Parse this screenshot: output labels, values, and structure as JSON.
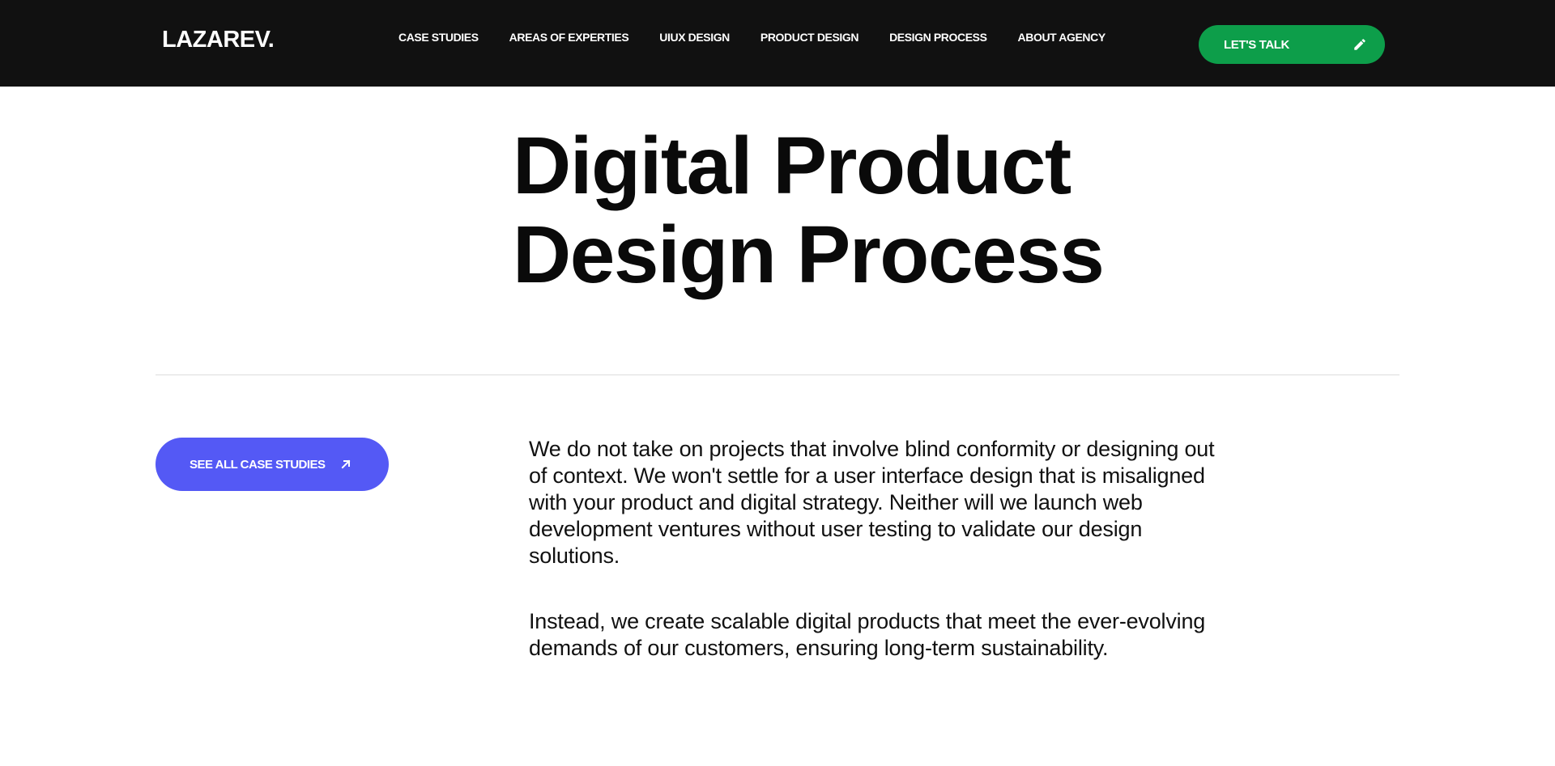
{
  "header": {
    "logo": "LAZAREV.",
    "nav": [
      "CASE STUDIES",
      "AREAS OF EXPERTIES",
      "UIUX DESIGN",
      "PRODUCT DESIGN",
      "DESIGN PROCESS",
      "ABOUT AGENCY"
    ],
    "cta_label": "LET'S TALK",
    "cta_icon": "pencil-icon",
    "cta_color": "#0d9e4a",
    "background": "#111111"
  },
  "hero": {
    "title_line1": "Digital Product",
    "title_line2": "Design Process"
  },
  "content": {
    "cases_button_label": "SEE ALL CASE STUDIES",
    "cases_button_icon": "arrow-up-right-icon",
    "cases_button_color": "#5459f5",
    "paragraph1": "We do not take on projects that involve blind conformity or designing out of context. We won't settle for a user interface design that is misaligned with your product and digital strategy. Neither will we launch web development ventures without user testing to validate our design solutions.",
    "paragraph2": "Instead, we create scalable digital products that meet the ever-evolving demands of our customers, ensuring long-term sustainability."
  }
}
